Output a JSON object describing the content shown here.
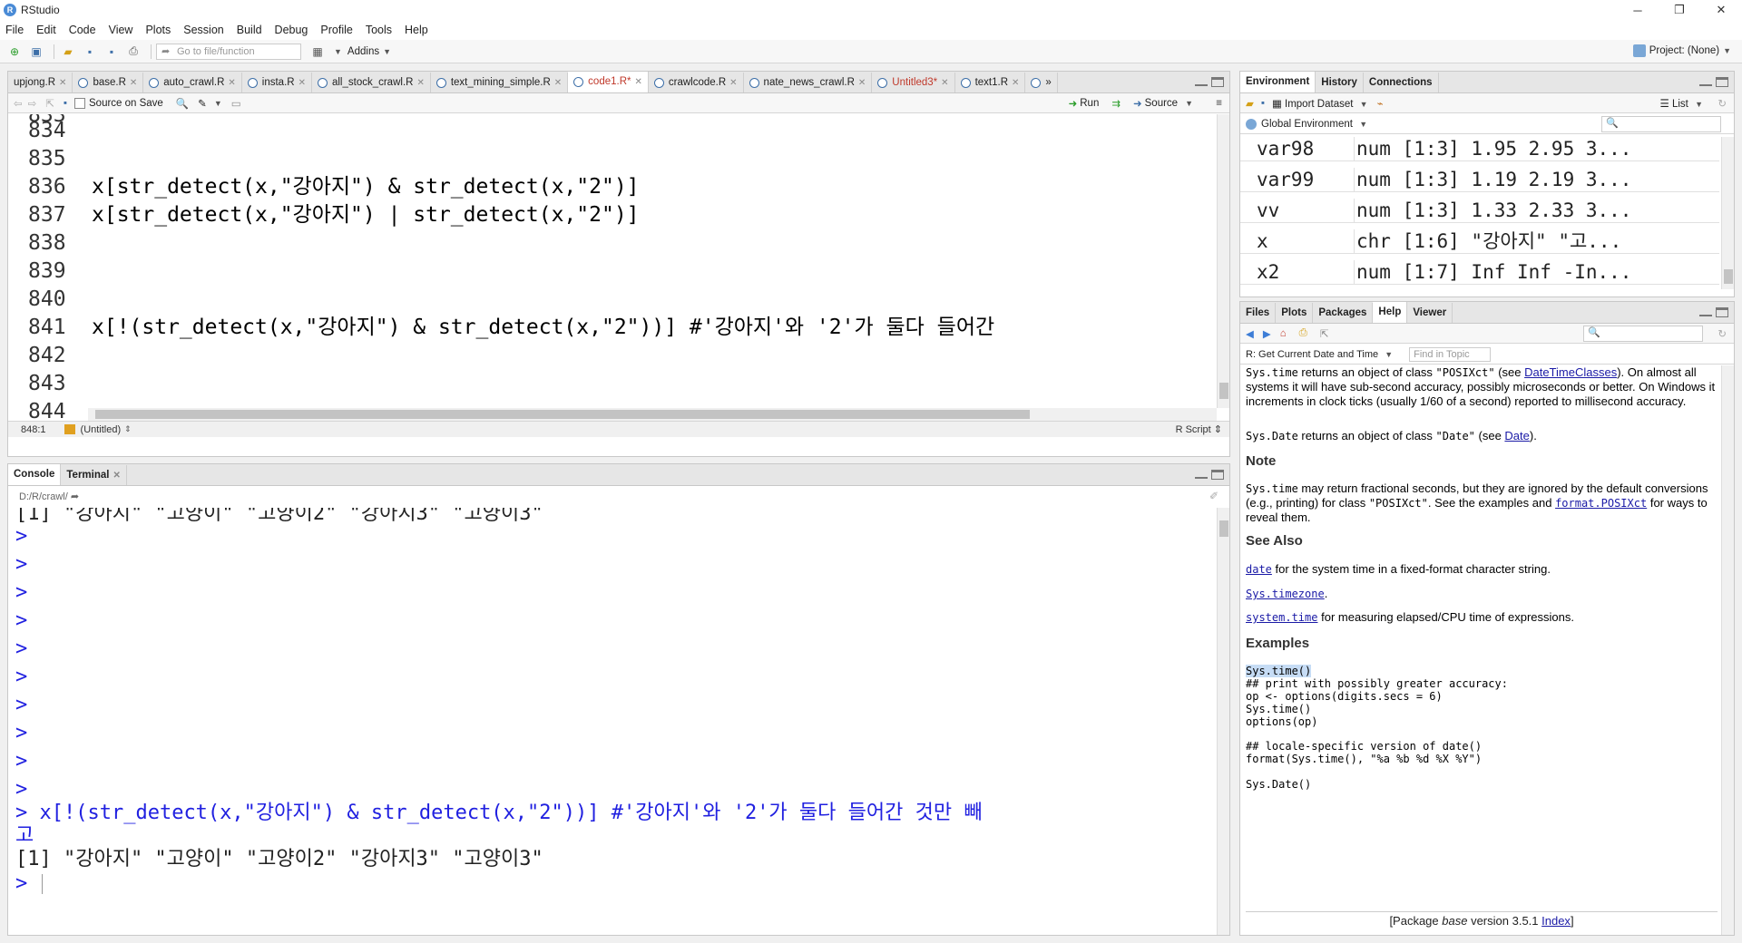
{
  "window": {
    "title": "RStudio",
    "app_icon": "R"
  },
  "menu": [
    "File",
    "Edit",
    "Code",
    "View",
    "Plots",
    "Session",
    "Build",
    "Debug",
    "Profile",
    "Tools",
    "Help"
  ],
  "toolbar": {
    "goto_placeholder": "Go to file/function",
    "addins": "Addins",
    "project": "Project: (None)"
  },
  "editor": {
    "tabs": [
      {
        "label": "upjong.R"
      },
      {
        "label": "base.R"
      },
      {
        "label": "auto_crawl.R"
      },
      {
        "label": "insta.R"
      },
      {
        "label": "all_stock_crawl.R"
      },
      {
        "label": "text_mining_simple.R"
      },
      {
        "label": "code1.R*"
      },
      {
        "label": "crawlcode.R"
      },
      {
        "label": "nate_news_crawl.R"
      },
      {
        "label": "Untitled3*"
      },
      {
        "label": "text1.R"
      }
    ],
    "source_on_save": "Source on Save",
    "run": "Run",
    "source": "Source",
    "lines": [
      {
        "n": "834",
        "code": ""
      },
      {
        "n": "835",
        "code": ""
      },
      {
        "n": "836",
        "code": "x[str_detect(x,\"강아지\") & str_detect(x,\"2\")]"
      },
      {
        "n": "837",
        "code": "x[str_detect(x,\"강아지\") | str_detect(x,\"2\")]"
      },
      {
        "n": "838",
        "code": ""
      },
      {
        "n": "839",
        "code": ""
      },
      {
        "n": "840",
        "code": ""
      },
      {
        "n": "841",
        "code": "x[!(str_detect(x,\"강아지\") & str_detect(x,\"2\"))] #'강아지'와 '2'가 둘다 들어간"
      },
      {
        "n": "842",
        "code": ""
      },
      {
        "n": "843",
        "code": ""
      },
      {
        "n": "844",
        "code": ""
      }
    ],
    "status_pos": "848:1",
    "status_scope": "(Untitled)",
    "status_type": "R Script"
  },
  "console": {
    "tabs": [
      "Console",
      "Terminal"
    ],
    "path": "D:/R/crawl/",
    "lines": [
      {
        "p": "",
        "t": "[1] \"강아지\"  \"고양이\"  \"고양이2\" \"강아지3\" \"고양이3\""
      },
      {
        "p": ">",
        "t": ""
      },
      {
        "p": ">",
        "t": ""
      },
      {
        "p": ">",
        "t": ""
      },
      {
        "p": ">",
        "t": ""
      },
      {
        "p": ">",
        "t": ""
      },
      {
        "p": ">",
        "t": ""
      },
      {
        "p": ">",
        "t": ""
      },
      {
        "p": ">",
        "t": ""
      },
      {
        "p": ">",
        "t": ""
      },
      {
        "p": ">",
        "t": ""
      },
      {
        "p": ">",
        "t": "x[!(str_detect(x,\"강아지\") & str_detect(x,\"2\"))] #'강아지'와 '2'가 둘다 들어간 것만 빼"
      },
      {
        "p": "",
        "t": "고"
      },
      {
        "p": "",
        "t": "[1] \"강아지\"  \"고양이\"  \"고양이2\" \"강아지3\" \"고양이3\""
      },
      {
        "p": ">",
        "t": ""
      }
    ]
  },
  "environment": {
    "tabs": [
      "Environment",
      "History",
      "Connections"
    ],
    "import": "Import Dataset",
    "list": "List",
    "scope": "Global Environment",
    "rows": [
      {
        "name": "var98",
        "value": "num [1:3] 1.95 2.95 3..."
      },
      {
        "name": "var99",
        "value": "num [1:3] 1.19 2.19 3..."
      },
      {
        "name": "vv",
        "value": "num [1:3] 1.33 2.33 3..."
      },
      {
        "name": "x",
        "value": "chr [1:6] \"강아지\" \"고..."
      },
      {
        "name": "x2",
        "value": "num [1:7] Inf Inf -In..."
      }
    ]
  },
  "help": {
    "tabs": [
      "Files",
      "Plots",
      "Packages",
      "Help",
      "Viewer"
    ],
    "topic": "R: Get Current Date and Time",
    "find_placeholder": "Find in Topic",
    "p1_code": "Sys.time",
    "p1_a": " returns an object of class ",
    "p1_cls": "\"POSIXct\"",
    "p1_b": " (see ",
    "p1_link": "DateTimeClasses",
    "p1_c": "). On almost all systems it will have sub-second accuracy, possibly microseconds or better. On Windows it increments in clock ticks (usually 1/60 of a second) reported to millisecond accuracy.",
    "p2_code": "Sys.Date",
    "p2_a": " returns an object of class ",
    "p2_cls": "\"Date\"",
    "p2_b": " (see ",
    "p2_link": "Date",
    "p2_c": ").",
    "note_h": "Note",
    "note_code": "Sys.time",
    "note_a": " may return fractional seconds, but they are ignored by the default conversions (e.g., printing) for class ",
    "note_cls": "\"POSIXct\"",
    "note_b": ". See the examples and ",
    "note_link": "format.POSIXct",
    "note_c": " for ways to reveal them.",
    "see_h": "See Also",
    "see1_link": "date",
    "see1_t": " for the system time in a fixed-format character string.",
    "see2_link": "Sys.timezone",
    "see2_t": ".",
    "see3_link": "system.time",
    "see3_t": " for measuring elapsed/CPU time of expressions.",
    "ex_h": "Examples",
    "ex": [
      "Sys.time()",
      "## print with possibly greater accuracy:",
      "op <- options(digits.secs = 6)",
      "Sys.time()",
      "options(op)",
      "",
      "## locale-specific version of date()",
      "format(Sys.time(), \"%a %b %d %X %Y\")",
      "",
      "Sys.Date()"
    ],
    "footer_a": "[Package ",
    "footer_pkg": "base",
    "footer_b": " version 3.5.1 ",
    "footer_link": "Index",
    "footer_c": "]"
  }
}
